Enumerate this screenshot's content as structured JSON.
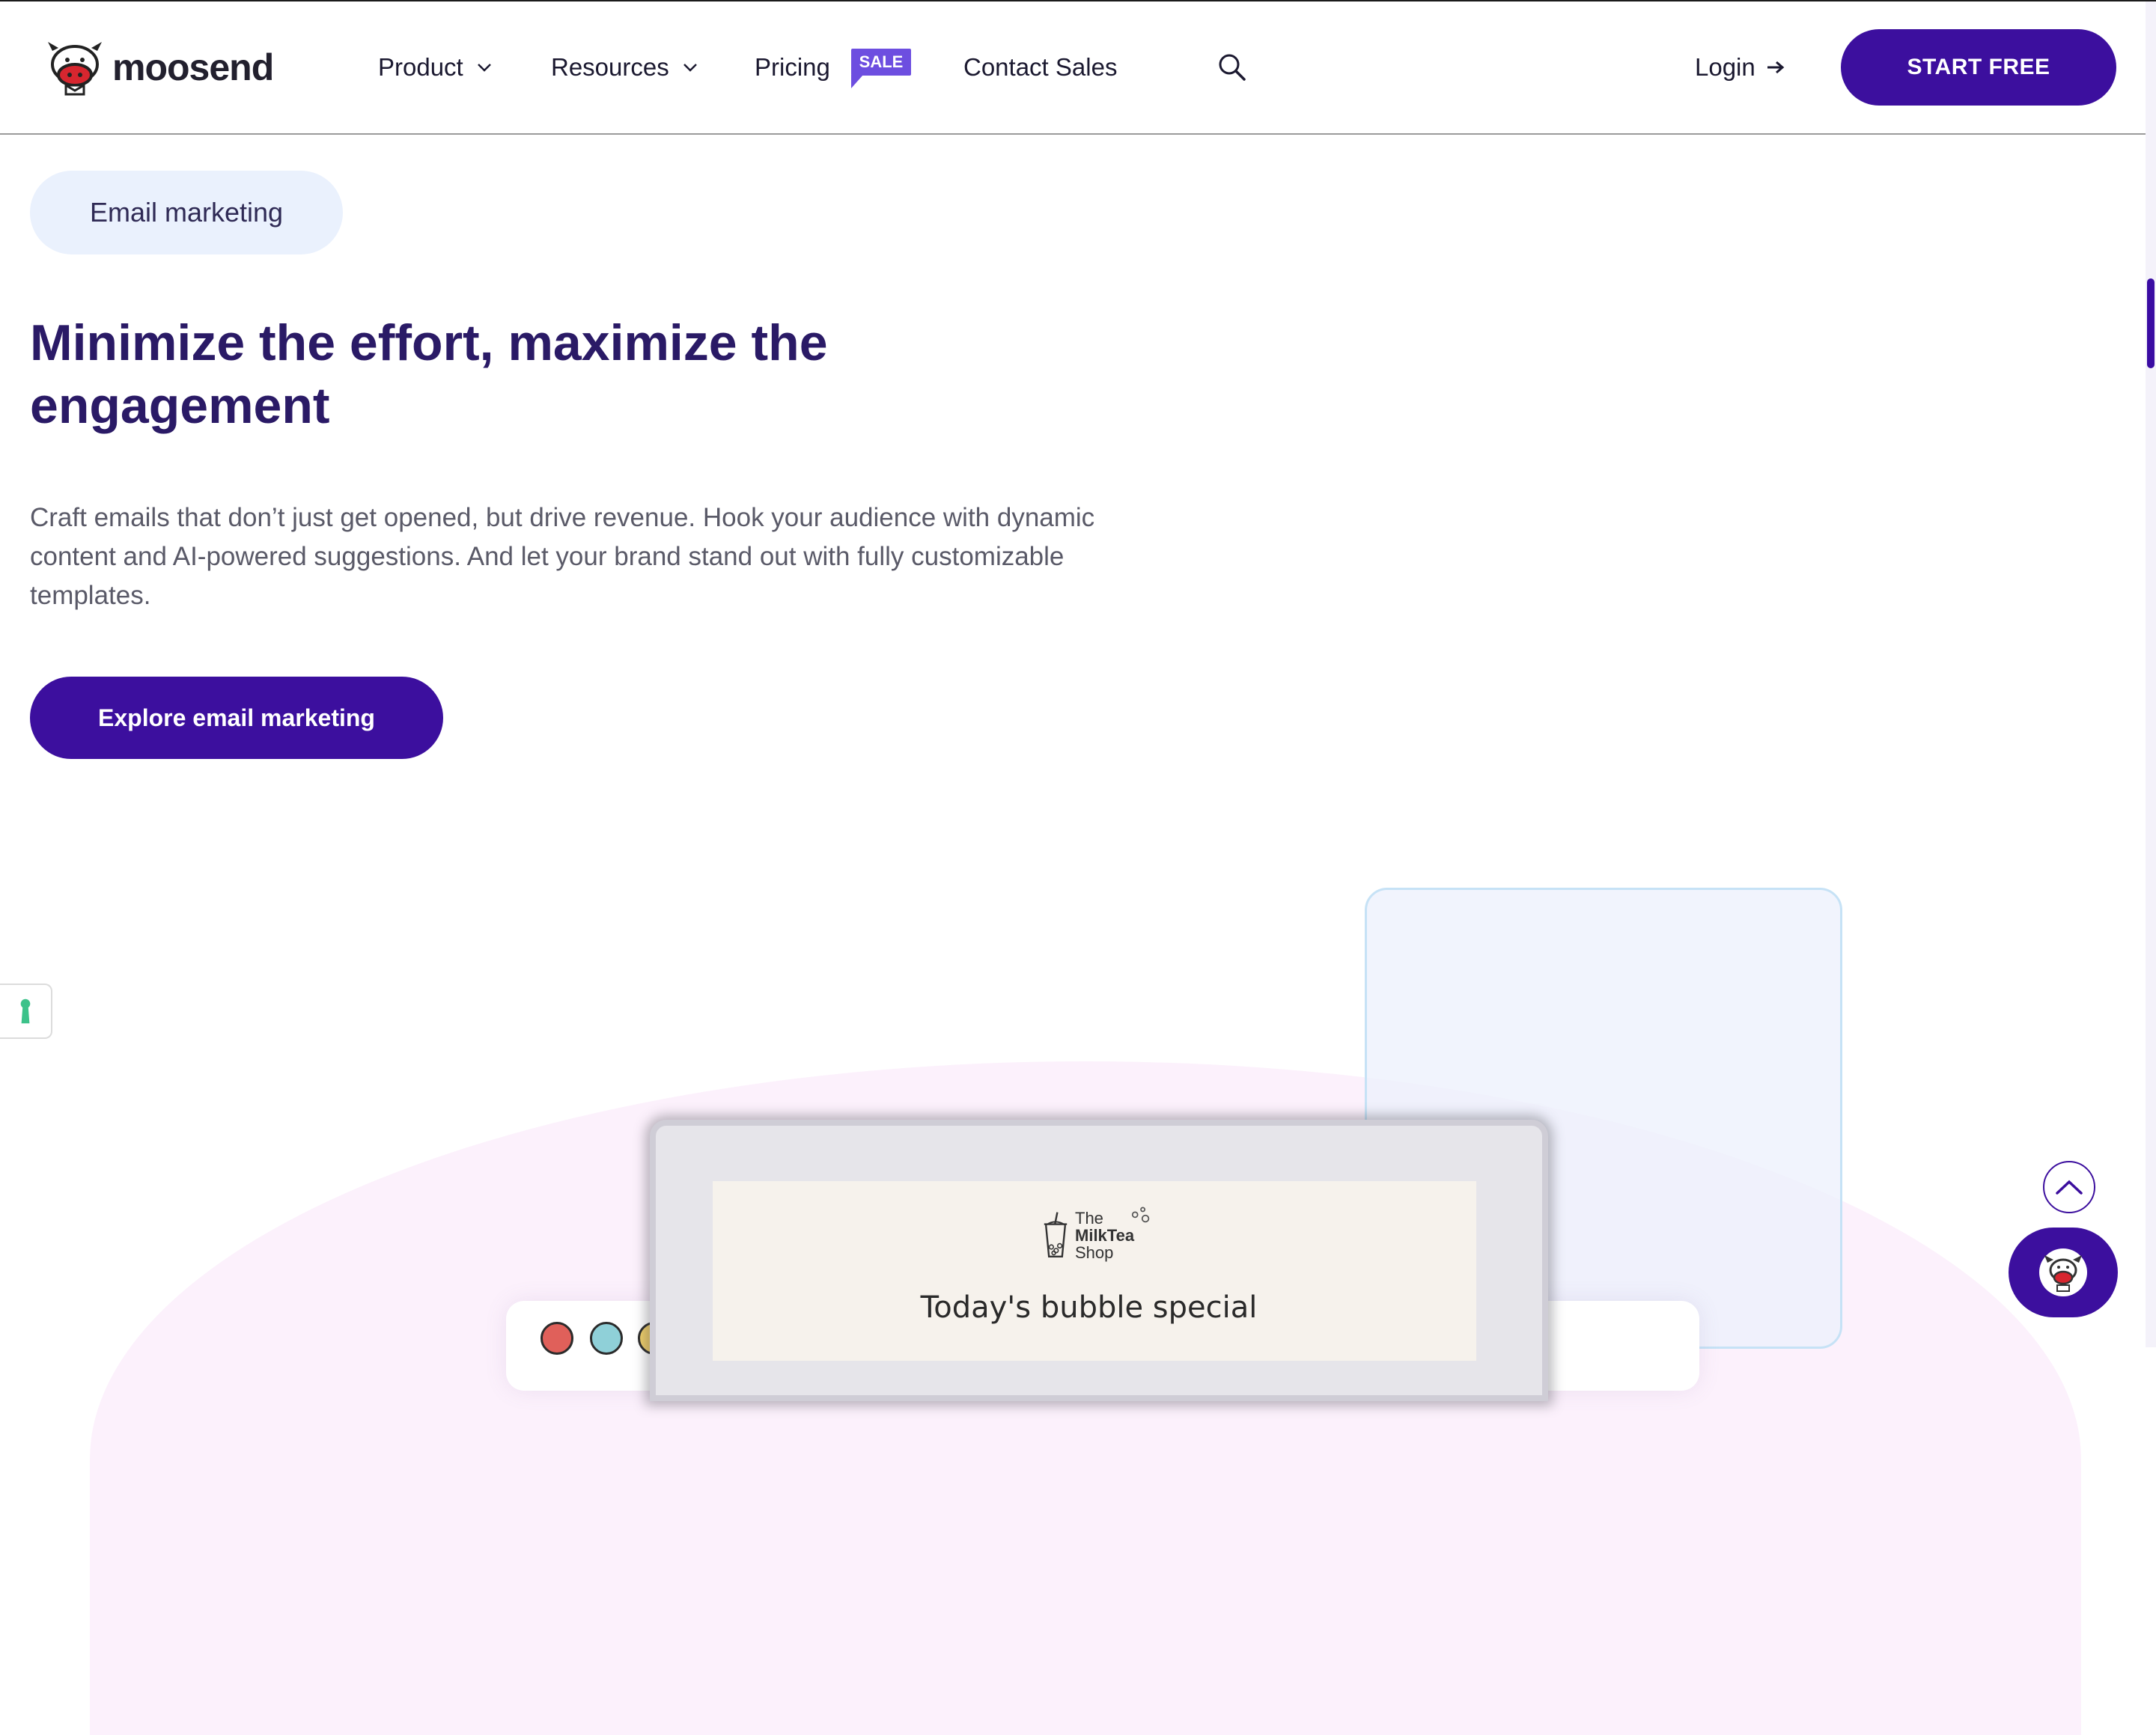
{
  "header": {
    "logo_text": "moosend",
    "nav": {
      "product": "Product",
      "resources": "Resources",
      "pricing": "Pricing",
      "sale_badge": "SALE",
      "contact_sales": "Contact Sales"
    },
    "login": "Login",
    "start_free": "START FREE"
  },
  "hero": {
    "pill": "Email marketing",
    "headline": "Minimize the effort, maximize the engagement",
    "description": "Craft emails that don’t just get opened, but drive revenue. Hook your audience with dynamic content and AI-powered suggestions. And let your brand stand out with fully customizable templates.",
    "cta": "Explore email marketing"
  },
  "illustration": {
    "brand_line1": "The",
    "brand_line2": "MilkTea",
    "brand_line3": "Shop",
    "email_heading": "Today's bubble special",
    "dot_colors": [
      "#e0605a",
      "#8fd0d8",
      "#f0cf6a"
    ]
  },
  "icons": {
    "search": "search-icon",
    "back_to_top": "chevron-up-icon",
    "chat": "moose-chat-icon",
    "accessibility": "keyhole-icon"
  },
  "colors": {
    "brand_primary": "#3c0f9e",
    "headline": "#2a1a66",
    "sale_badge": "#6d4ee0",
    "pill_bg": "#eaf1fd"
  }
}
